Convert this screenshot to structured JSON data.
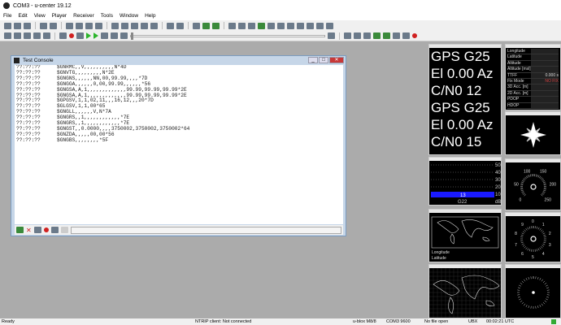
{
  "window": {
    "title": "COM3 - u-center 19.12"
  },
  "menu": [
    "File",
    "Edit",
    "View",
    "Player",
    "Receiver",
    "Tools",
    "Window",
    "Help"
  ],
  "console": {
    "title": "Test Console",
    "lines": [
      [
        "??:??:??",
        "$GNRMC,,V,,,,,,,,,,N*4D"
      ],
      [
        "??:??:??",
        "$GNVTG,,,,,,,,,N*2E"
      ],
      [
        "??:??:??",
        "$GNGNS,,,,,,NN,00,99.99,,,,*7D"
      ],
      [
        "??:??:??",
        "$GNGGA,,,,,,0,00,99.99,,,,,,*56"
      ],
      [
        "??:??:??",
        "$GNGSA,A,1,,,,,,,,,,,,,99.99,99.99,99.99*2E"
      ],
      [
        "??:??:??",
        "$GNGSA,A,1,,,,,,,,,,,,,99.99,99.99,99.99*2E"
      ],
      [
        "??:??:??",
        "$GPGSV,1,1,02,11,,,16,12,,,20*7D"
      ],
      [
        "??:??:??",
        "$GLGSV,1,1,00*65"
      ],
      [
        "??:??:??",
        "$GNGLL,,,,,,V,N*7A"
      ],
      [
        "??:??:??",
        "$GNGRS,,1,,,,,,,,,,,,*7E"
      ],
      [
        "??:??:??",
        "$GNGRS,,1,,,,,,,,,,,,*7E"
      ],
      [
        "??:??:??",
        "$GNGST,,0.0000,,,,3750002,3750002,3750002*64"
      ],
      [
        "??:??:??",
        "$GNZDA,,,,,00,00*56"
      ],
      [
        "??:??:??",
        "$GNGBS,,,,,,,,*5F"
      ]
    ]
  },
  "satellite_panel": {
    "lines": [
      "GPS G25",
      "El 0.00 Az",
      "C/N0 12",
      "GPS G25",
      "El 0.00 Az",
      "C/N0 15"
    ]
  },
  "signal_chart": {
    "ticks": [
      "50",
      "40",
      "30",
      "20",
      "10"
    ],
    "unit": "dB",
    "bar_value": "13",
    "sat": "G22"
  },
  "info_panel": {
    "rows": [
      [
        "Longitude",
        ""
      ],
      [
        "Latitude",
        ""
      ],
      [
        "Altitude",
        ""
      ],
      [
        "Altitude [msl]",
        ""
      ],
      [
        "TTFF",
        "0.000 s"
      ],
      [
        "Fix Mode",
        "NO FIX"
      ],
      [
        "3D Acc. [m]",
        ""
      ],
      [
        "2D Acc. [m]",
        ""
      ],
      [
        "PDOP",
        ""
      ],
      [
        "HDOP",
        ""
      ]
    ]
  },
  "map_panel": {
    "longitude_label": "Longitude",
    "latitude_label": "Latitude"
  },
  "speed_gauge": {
    "ticks": [
      "0",
      "50",
      "100",
      "150",
      "200",
      "250"
    ]
  },
  "clock_gauge": {
    "ticks": [
      "0",
      "1",
      "2",
      "3",
      "4",
      "5",
      "6",
      "7",
      "8",
      "9"
    ]
  },
  "status": {
    "ready": "Ready",
    "ntrip": "NTRIP client: Not connected",
    "receiver": "u-blox M8/8",
    "port": "COM3 9600",
    "file": "No file open",
    "protocol": "UBX",
    "time": "00:02:21 UTC"
  },
  "colors": {
    "accent": "#1a1aff",
    "fixmode": "#d04040"
  }
}
